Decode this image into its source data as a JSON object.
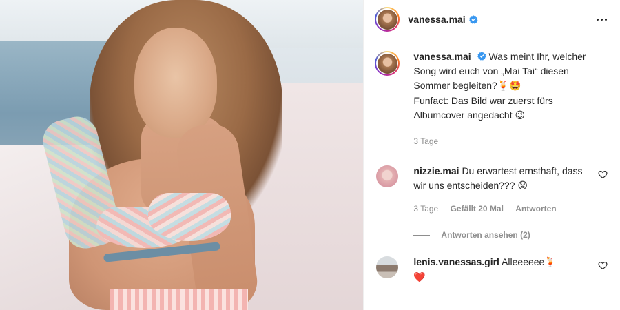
{
  "post": {
    "author": "vanessa.mai",
    "caption": {
      "username": "vanessa.mai",
      "line1": "Was meint Ihr, welcher Song wird euch von „Mai Tai“ diesen Sommer begleiten?",
      "emoji1": "🍹🤩",
      "line2": "Funfact: Das Bild war zuerst fürs Albumcover angedacht",
      "emoji2": "😉",
      "time": "3 Tage"
    },
    "comments": [
      {
        "username": "nizzie.mai",
        "text": "Du erwartest ernsthaft, dass wir uns entscheiden???",
        "emoji": "😟",
        "time": "3 Tage",
        "likes": "Gefällt 20 Mal",
        "reply_label": "Antworten",
        "view_replies": "Antworten ansehen (2)"
      },
      {
        "username": "lenis.vanessas.girl",
        "text": "Alleeeeee",
        "emoji": "🍹",
        "emoji_line2": "❤️"
      }
    ]
  },
  "icons": {
    "verified": "verified-badge-icon",
    "more": "more-options-icon",
    "like": "heart-outline-icon"
  },
  "colors": {
    "verified_blue": "#3897f0",
    "meta_gray": "#8e8e8e",
    "text": "#262626"
  }
}
